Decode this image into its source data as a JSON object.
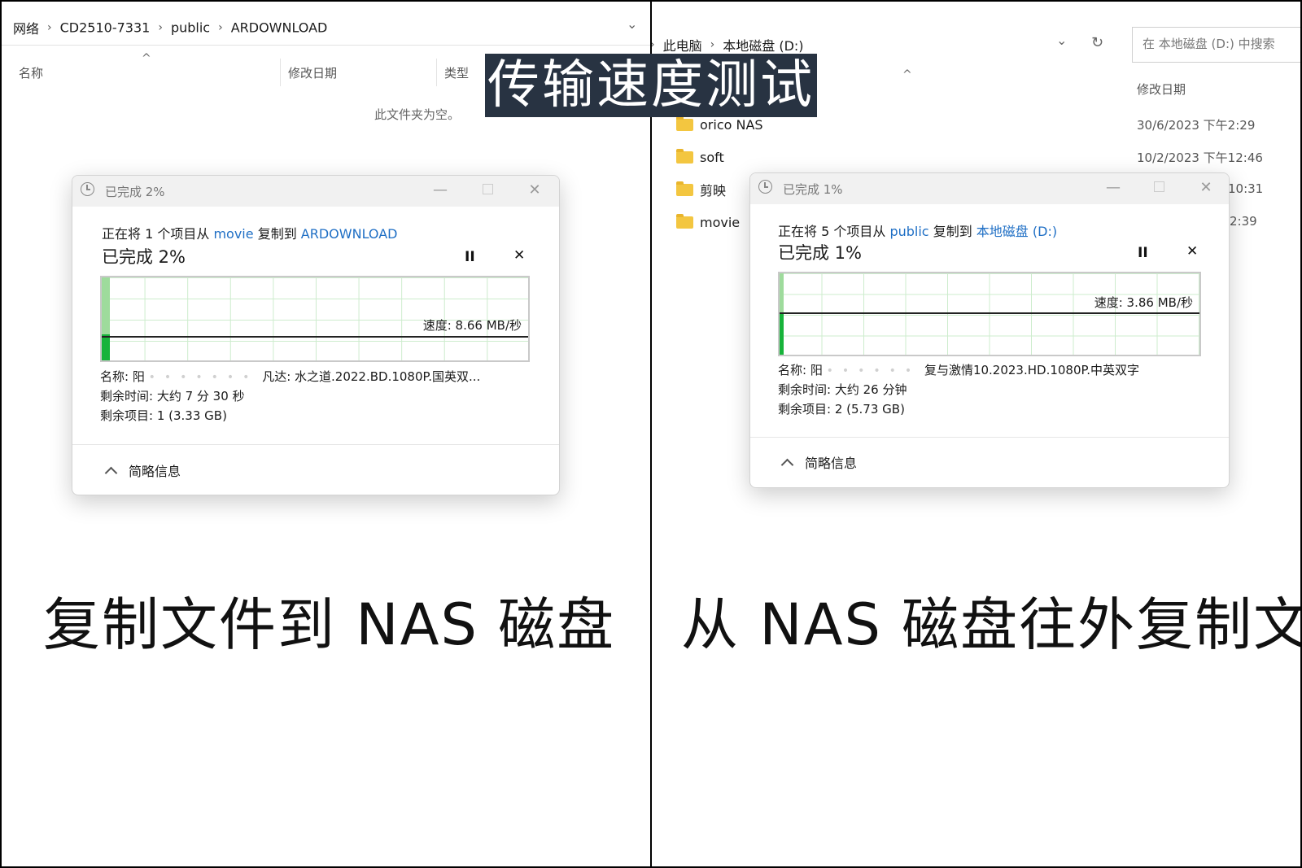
{
  "overlay_title": "传输速度测试",
  "left": {
    "breadcrumb": [
      "网络",
      "CD2510-7331",
      "public",
      "ARDOWNLOAD"
    ],
    "columns": {
      "name": "名称",
      "modified": "修改日期",
      "type": "类型"
    },
    "empty_text": "此文件夹为空。",
    "dialog": {
      "title": "已完成 2%",
      "line1_prefix": "正在将 1 个项目从",
      "source": "movie",
      "line1_mid": "复制到",
      "destination": "ARDOWNLOAD",
      "percent_text": "已完成 2%",
      "progress_percent": 2,
      "pause_label": "II",
      "cancel_label": "✕",
      "speed": "速度: 8.66 MB/秒",
      "name_label": "名称: 阳",
      "name_value": "凡达: 水之道.2022.BD.1080P.国英双...",
      "time_left": "剩余时间: 大约 7 分 30 秒",
      "items_left": "剩余项目: 1 (3.33 GB)",
      "footer": "简略信息"
    },
    "caption": "复制文件到 NAS 磁盘"
  },
  "right": {
    "breadcrumb": [
      "此电脑",
      "本地磁盘 (D:)"
    ],
    "search_placeholder": "在 本地磁盘 (D:) 中搜索",
    "columns": {
      "modified": "修改日期"
    },
    "folders": [
      {
        "name": "orico NAS",
        "date": "30/6/2023 下午2:29"
      },
      {
        "name": "soft",
        "date": "10/2/2023 下午12:46"
      },
      {
        "name": "剪映",
        "date": "10:31"
      },
      {
        "name": "movie",
        "date": "2:39"
      }
    ],
    "dialog": {
      "title": "已完成 1%",
      "line1_prefix": "正在将 5 个项目从",
      "source": "public",
      "line1_mid": "复制到",
      "destination": "本地磁盘 (D:)",
      "percent_text": "已完成 1%",
      "progress_percent": 1,
      "pause_label": "II",
      "cancel_label": "✕",
      "speed": "速度: 3.86 MB/秒",
      "name_label": "名称: 阳",
      "name_value": "复与激情10.2023.HD.1080P.中英双字",
      "time_left": "剩余时间: 大约 26 分钟",
      "items_left": "剩余项目: 2 (5.73 GB)",
      "footer": "简略信息"
    },
    "caption": "从 NAS 磁盘往外复制文件"
  },
  "colors": {
    "progress_light": "#9edb9c",
    "progress_dark": "#17b33a",
    "link": "#1f6fc5",
    "overlay_bg": "#283342"
  }
}
